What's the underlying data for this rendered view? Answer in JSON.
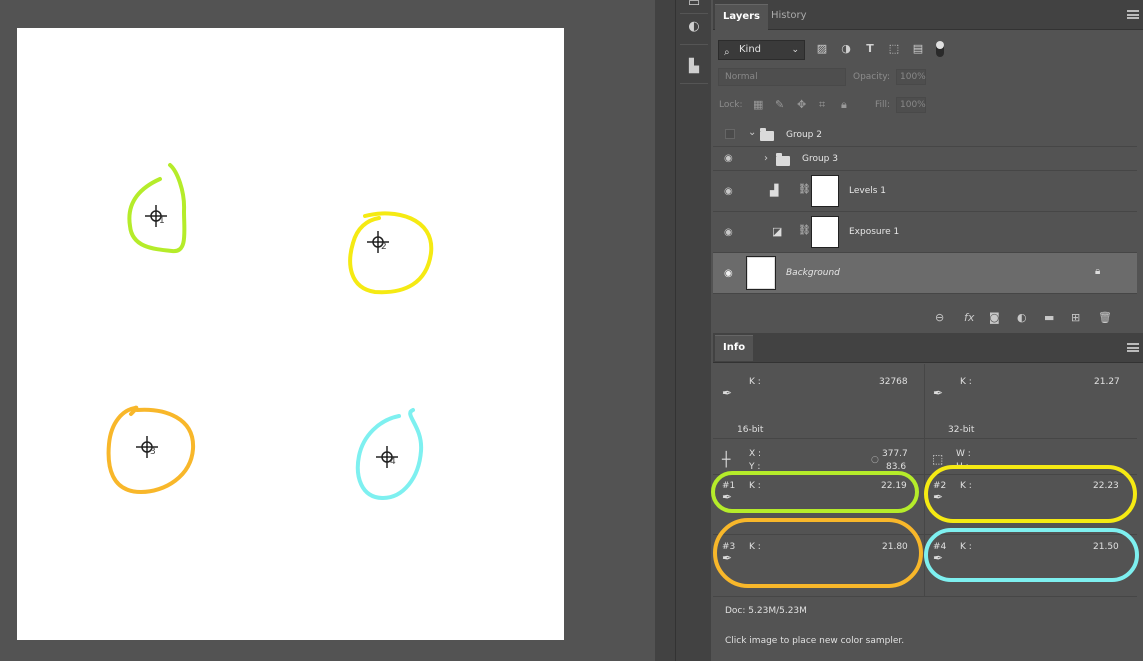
{
  "canvas": {
    "samplers": [
      {
        "num": "1",
        "ring_color": "#b5ec2a"
      },
      {
        "num": "2",
        "ring_color": "#f5ea13"
      },
      {
        "num": "3",
        "ring_color": "#f8b72a"
      },
      {
        "num": "4",
        "ring_color": "#7ef0f0"
      }
    ]
  },
  "layers_panel": {
    "tabs": [
      "Layers",
      "History"
    ],
    "kind_filter": "Kind",
    "blend_mode": "Normal",
    "opacity_label": "Opacity:",
    "opacity_value": "100%",
    "lock_label": "Lock:",
    "fill_label": "Fill:",
    "fill_value": "100%",
    "layers": [
      {
        "name": "Group 2",
        "type": "group",
        "visible": false,
        "expanded": true
      },
      {
        "name": "Group 3",
        "type": "group",
        "visible": true,
        "expanded": false
      },
      {
        "name": "Levels 1",
        "type": "levels-adjustment",
        "visible": true
      },
      {
        "name": "Exposure 1",
        "type": "exposure-adjustment",
        "visible": true
      },
      {
        "name": "Background",
        "type": "background",
        "visible": true,
        "locked": true,
        "selected": true
      }
    ]
  },
  "info_panel": {
    "tab": "Info",
    "primary": {
      "k_label": "K :",
      "k_value": "32768",
      "bit_depth": "16-bit"
    },
    "secondary": {
      "k_label": "K :",
      "k_value": "21.27",
      "bit_depth": "32-bit"
    },
    "xy": {
      "x_label": "X :",
      "y_label": "Y :",
      "x_value": "377.7",
      "y_value": "83.6"
    },
    "wh": {
      "w_label": "W :",
      "h_label": "H :"
    },
    "samples": [
      {
        "id": "#1",
        "label": "K :",
        "value": "22.19",
        "highlight": "#b5ec2a"
      },
      {
        "id": "#2",
        "label": "K :",
        "value": "22.23",
        "highlight": "#f5ea13"
      },
      {
        "id": "#3",
        "label": "K :",
        "value": "21.80",
        "highlight": "#f8b72a"
      },
      {
        "id": "#4",
        "label": "K :",
        "value": "21.50",
        "highlight": "#7ef0f0"
      }
    ],
    "doc": "Doc: 5.23M/5.23M",
    "hint": "Click image to place new color sampler."
  },
  "colors": {
    "panel_bg": "#535353",
    "dark_bg": "#424242",
    "selected_layer": "#6b6b6b"
  }
}
